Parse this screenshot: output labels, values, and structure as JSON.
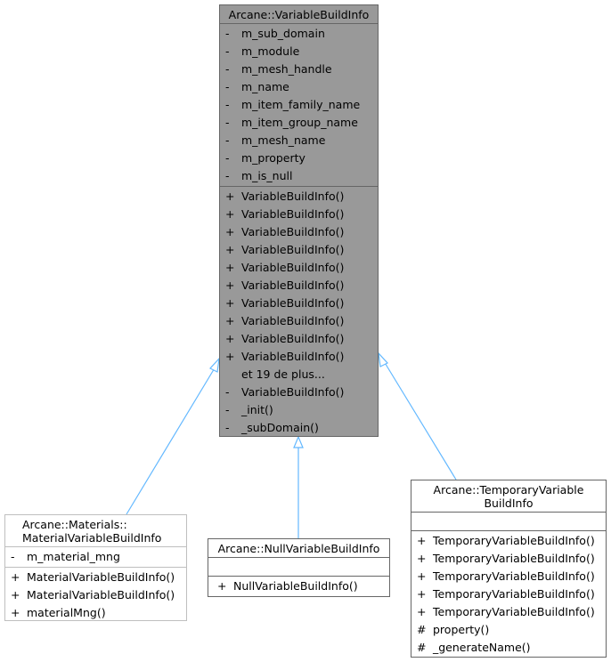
{
  "diagram": {
    "edge_color": "#63b8ff",
    "base_class": {
      "title": "Arcane::VariableBuildInfo",
      "attributes": [
        {
          "vis": "-",
          "name": "m_sub_domain"
        },
        {
          "vis": "-",
          "name": "m_module"
        },
        {
          "vis": "-",
          "name": "m_mesh_handle"
        },
        {
          "vis": "-",
          "name": "m_name"
        },
        {
          "vis": "-",
          "name": "m_item_family_name"
        },
        {
          "vis": "-",
          "name": "m_item_group_name"
        },
        {
          "vis": "-",
          "name": "m_mesh_name"
        },
        {
          "vis": "-",
          "name": "m_property"
        },
        {
          "vis": "-",
          "name": "m_is_null"
        }
      ],
      "methods": [
        {
          "vis": "+",
          "name": "VariableBuildInfo()"
        },
        {
          "vis": "+",
          "name": "VariableBuildInfo()"
        },
        {
          "vis": "+",
          "name": "VariableBuildInfo()"
        },
        {
          "vis": "+",
          "name": "VariableBuildInfo()"
        },
        {
          "vis": "+",
          "name": "VariableBuildInfo()"
        },
        {
          "vis": "+",
          "name": "VariableBuildInfo()"
        },
        {
          "vis": "+",
          "name": "VariableBuildInfo()"
        },
        {
          "vis": "+",
          "name": "VariableBuildInfo()"
        },
        {
          "vis": "+",
          "name": "VariableBuildInfo()"
        },
        {
          "vis": "+",
          "name": "VariableBuildInfo()"
        },
        {
          "vis": "",
          "name": "et 19 de plus..."
        },
        {
          "vis": "-",
          "name": "VariableBuildInfo()"
        },
        {
          "vis": "-",
          "name": "_init()"
        },
        {
          "vis": "-",
          "name": "_subDomain()"
        }
      ]
    },
    "material_class": {
      "title_line1": "Arcane::Materials::",
      "title_line2": "MaterialVariableBuildInfo",
      "attributes": [
        {
          "vis": "-",
          "name": "m_material_mng"
        }
      ],
      "methods": [
        {
          "vis": "+",
          "name": "MaterialVariableBuildInfo()"
        },
        {
          "vis": "+",
          "name": "MaterialVariableBuildInfo()"
        },
        {
          "vis": "+",
          "name": "materialMng()"
        }
      ]
    },
    "null_class": {
      "title": "Arcane::NullVariableBuildInfo",
      "methods": [
        {
          "vis": "+",
          "name": "NullVariableBuildInfo()"
        }
      ]
    },
    "temporary_class": {
      "title_line1": "Arcane::TemporaryVariable",
      "title_line2": "BuildInfo",
      "methods": [
        {
          "vis": "+",
          "name": "TemporaryVariableBuildInfo()"
        },
        {
          "vis": "+",
          "name": "TemporaryVariableBuildInfo()"
        },
        {
          "vis": "+",
          "name": "TemporaryVariableBuildInfo()"
        },
        {
          "vis": "+",
          "name": "TemporaryVariableBuildInfo()"
        },
        {
          "vis": "+",
          "name": "TemporaryVariableBuildInfo()"
        },
        {
          "vis": "#",
          "name": "property()"
        },
        {
          "vis": "#",
          "name": "_generateName()"
        }
      ]
    }
  }
}
